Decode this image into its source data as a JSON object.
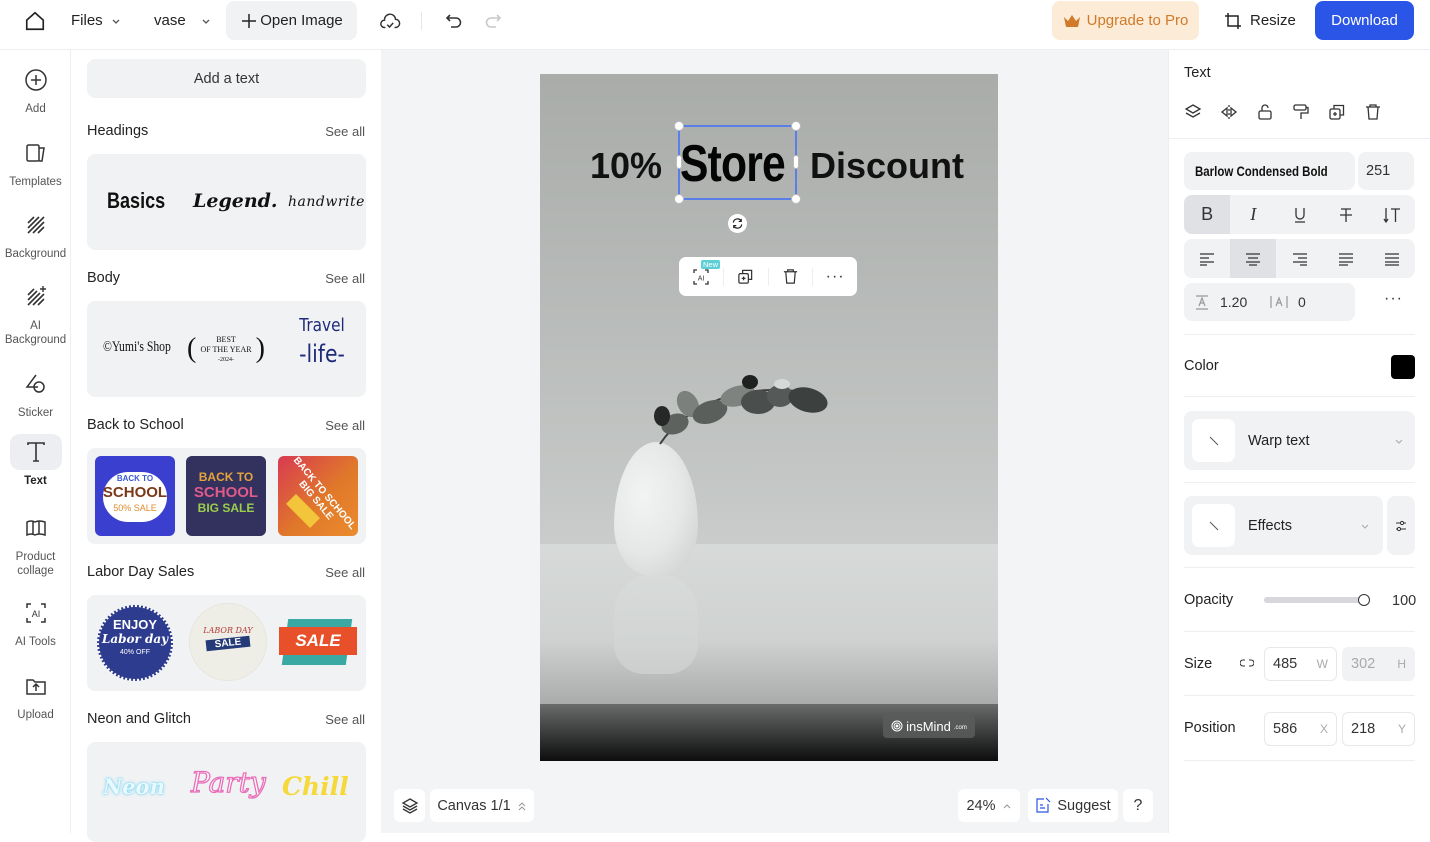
{
  "topbar": {
    "files_label": "Files",
    "project_name": "vase",
    "open_image_label": "Open Image",
    "upgrade_label": "Upgrade to Pro",
    "resize_label": "Resize",
    "download_label": "Download",
    "colors": {
      "upgrade_bg": "#fcebd6",
      "upgrade_text": "#d07a2a",
      "download_bg": "#2b55e6"
    }
  },
  "leftnav": {
    "items": [
      {
        "label": "Add",
        "icon": "plus-circle-icon"
      },
      {
        "label": "Templates",
        "icon": "templates-icon"
      },
      {
        "label": "Background",
        "icon": "background-hatch-icon"
      },
      {
        "label": "AI Background",
        "icon": "ai-background-icon"
      },
      {
        "label": "Sticker",
        "icon": "sticker-icon"
      },
      {
        "label": "Text",
        "icon": "text-icon",
        "active": true
      },
      {
        "label": "Product collage",
        "icon": "collage-icon"
      },
      {
        "label": "AI Tools",
        "icon": "ai-tools-icon"
      },
      {
        "label": "Upload",
        "icon": "upload-icon"
      }
    ]
  },
  "panel": {
    "add_text_label": "Add a text",
    "see_all": "See all",
    "sections": [
      {
        "title": "Headings",
        "samples": [
          "Basics",
          "Legend.",
          "handwrite"
        ]
      },
      {
        "title": "Body",
        "samples": [
          "©Yumi's Shop",
          "BEST",
          "OF THE YEAR",
          "-2024-",
          "Travel",
          "-life-"
        ]
      },
      {
        "title": "Back to School",
        "samples": [
          "BACK TO",
          "SCHOOL",
          "50% SALE",
          "BACK TO",
          "SCHOOL",
          "BIG SALE",
          "BACK TO SCHOOL BIG SALE"
        ]
      },
      {
        "title": "Labor Day Sales",
        "samples": [
          "ENJOY",
          "Labor day",
          "40% OFF",
          "LABOR DAY",
          "SALE",
          "SALE"
        ]
      },
      {
        "title": "Neon and Glitch",
        "samples": [
          "Neon",
          "Party",
          "Chill"
        ]
      }
    ]
  },
  "canvas": {
    "text_left": "10%",
    "text_selected": "Store",
    "text_right": "Discount",
    "ai_badge": "New",
    "ai_label": "AI",
    "watermark": "insMind",
    "watermark_suffix": ".com",
    "selection_color": "#5b7fe8"
  },
  "bottombar": {
    "canvas_label": "Canvas 1/1",
    "zoom": "24%",
    "suggest_label": "Suggest",
    "help_label": "?"
  },
  "rightpanel": {
    "title": "Text",
    "font_name": "Barlow Condensed Bold",
    "font_size": "251",
    "line_height": "1.20",
    "letter_spacing": "0",
    "color_label": "Color",
    "color_value": "#000000",
    "warp_label": "Warp text",
    "effects_label": "Effects",
    "opacity_label": "Opacity",
    "opacity_value": "100",
    "opacity_fraction": 1.0,
    "size_label": "Size",
    "width": "485",
    "width_unit": "W",
    "height": "302",
    "height_unit": "H",
    "position_label": "Position",
    "x": "586",
    "x_unit": "X",
    "y": "218",
    "y_unit": "Y"
  }
}
